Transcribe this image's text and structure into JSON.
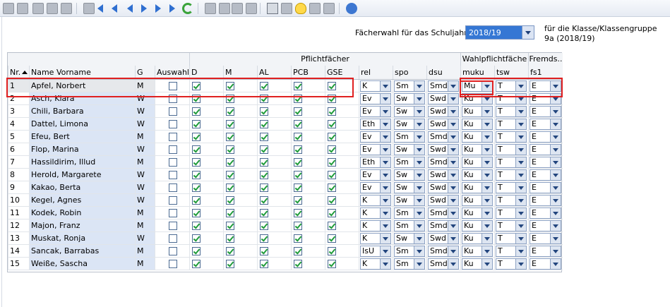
{
  "toolbar": {
    "icons": [
      "new-icon",
      "save-icon",
      "undo-icon",
      "delete-icon",
      "form-icon",
      "list-icon",
      "first-icon",
      "prev-page-icon",
      "prev-icon",
      "next-icon",
      "next-page-icon",
      "last-icon",
      "refresh-icon",
      "back-icon",
      "cut-icon",
      "copy-icon",
      "paste-icon",
      "print-icon",
      "preview-icon",
      "bulb-icon",
      "brush-icon",
      "window-icon",
      "help-icon"
    ]
  },
  "school_year": {
    "label": "Fächerwahl für das Schuljahr",
    "value": "2018/19"
  },
  "class_info": {
    "line1": "für die Klasse/Klassengruppe",
    "line2": "9a (2018/19)"
  },
  "groups": {
    "pflicht": "Pflichtfächer",
    "wahlpflicht": "Wahlpflichtfäche",
    "fremd": "Fremds.."
  },
  "columns": {
    "nr": "Nr.",
    "name": "Name Vorname",
    "g": "G",
    "auswahl": "Auswahl",
    "d": "D",
    "m": "M",
    "al": "AL",
    "pcb": "PCB",
    "gse": "GSE",
    "rel": "rel",
    "spo": "spo",
    "dsu": "dsu",
    "muku": "muku",
    "tsw": "tsw",
    "fs1": "fs1"
  },
  "rows": [
    {
      "nr": "1",
      "name": "Apfel, Norbert",
      "g": "M",
      "rel": "K",
      "spo": "Sm",
      "dsu": "Smd",
      "muku": "Mu",
      "tsw": "T",
      "fs1": "E"
    },
    {
      "nr": "2",
      "name": "Asch, Klara",
      "g": "W",
      "rel": "Ev",
      "spo": "Sw",
      "dsu": "Swd",
      "muku": "Ku",
      "tsw": "T",
      "fs1": "E"
    },
    {
      "nr": "3",
      "name": "Chili, Barbara",
      "g": "W",
      "rel": "Ev",
      "spo": "Sw",
      "dsu": "Swd",
      "muku": "Ku",
      "tsw": "T",
      "fs1": "E"
    },
    {
      "nr": "4",
      "name": "Dattel, Limona",
      "g": "W",
      "rel": "Eth",
      "spo": "Sw",
      "dsu": "Swd",
      "muku": "Ku",
      "tsw": "T",
      "fs1": "E"
    },
    {
      "nr": "5",
      "name": "Efeu, Bert",
      "g": "M",
      "rel": "Ev",
      "spo": "Sm",
      "dsu": "Smd",
      "muku": "Ku",
      "tsw": "T",
      "fs1": "E"
    },
    {
      "nr": "6",
      "name": "Flop, Marina",
      "g": "W",
      "rel": "Ev",
      "spo": "Sw",
      "dsu": "Swd",
      "muku": "Ku",
      "tsw": "T",
      "fs1": "E"
    },
    {
      "nr": "7",
      "name": "Hassildirim, Illud",
      "g": "M",
      "rel": "Eth",
      "spo": "Sm",
      "dsu": "Smd",
      "muku": "Ku",
      "tsw": "T",
      "fs1": "E"
    },
    {
      "nr": "8",
      "name": "Herold, Margarete",
      "g": "W",
      "rel": "Ev",
      "spo": "Sw",
      "dsu": "Swd",
      "muku": "Ku",
      "tsw": "T",
      "fs1": "E"
    },
    {
      "nr": "9",
      "name": "Kakao, Berta",
      "g": "W",
      "rel": "Ev",
      "spo": "Sw",
      "dsu": "Swd",
      "muku": "Ku",
      "tsw": "T",
      "fs1": "E"
    },
    {
      "nr": "10",
      "name": "Kegel, Agnes",
      "g": "W",
      "rel": "K",
      "spo": "Sw",
      "dsu": "Swd",
      "muku": "Ku",
      "tsw": "T",
      "fs1": "E"
    },
    {
      "nr": "11",
      "name": "Kodek, Robin",
      "g": "M",
      "rel": "K",
      "spo": "Sm",
      "dsu": "Smd",
      "muku": "Ku",
      "tsw": "T",
      "fs1": "E"
    },
    {
      "nr": "12",
      "name": "Majon, Franz",
      "g": "M",
      "rel": "K",
      "spo": "Sm",
      "dsu": "Smd",
      "muku": "Ku",
      "tsw": "T",
      "fs1": "E"
    },
    {
      "nr": "13",
      "name": "Muskat, Ronja",
      "g": "W",
      "rel": "K",
      "spo": "Sw",
      "dsu": "Swd",
      "muku": "Ku",
      "tsw": "T",
      "fs1": "E"
    },
    {
      "nr": "14",
      "name": "Sancak, Barrabas",
      "g": "M",
      "rel": "IsU",
      "spo": "Sm",
      "dsu": "Smd",
      "muku": "Ku",
      "tsw": "T",
      "fs1": "E"
    },
    {
      "nr": "15",
      "name": "Weiße, Sascha",
      "g": "M",
      "rel": "K",
      "spo": "Sm",
      "dsu": "Smd",
      "muku": "Ku",
      "tsw": "T",
      "fs1": "E"
    }
  ]
}
